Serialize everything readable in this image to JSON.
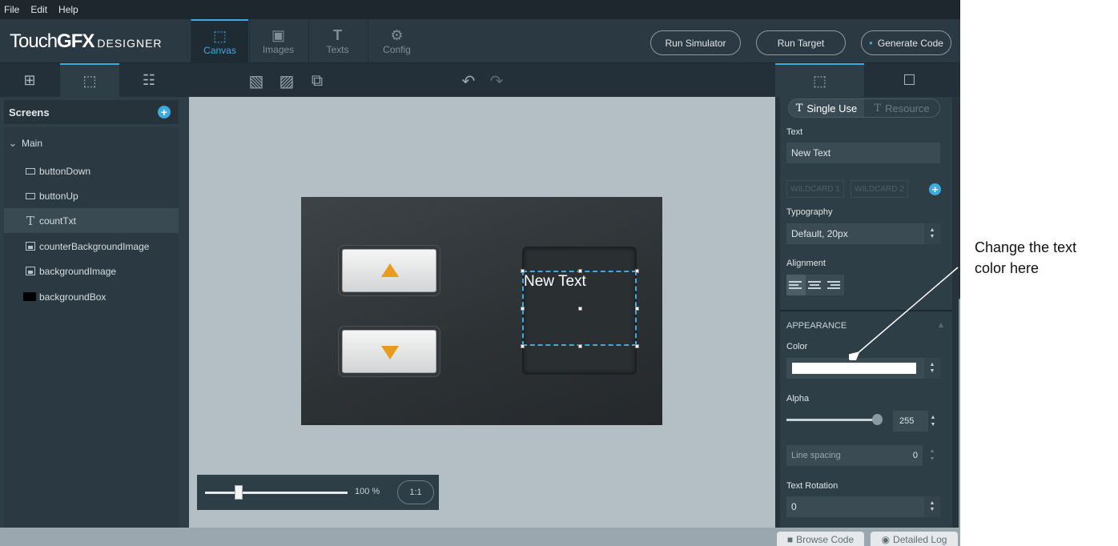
{
  "menu": [
    "File",
    "Edit",
    "Help"
  ],
  "logo": {
    "part1": "Touch",
    "part2": "GFX",
    "part3": "DESIGNER"
  },
  "top_tabs": [
    {
      "label": "Canvas",
      "icon": "canvas-icon"
    },
    {
      "label": "Images",
      "icon": "image-icon"
    },
    {
      "label": "Texts",
      "icon": "text-icon"
    },
    {
      "label": "Config",
      "icon": "gear-icon"
    }
  ],
  "actions": {
    "run_simulator": "Run Simulator",
    "run_target": "Run Target",
    "generate_code": "Generate Code"
  },
  "left_panel": {
    "screens_title": "Screens",
    "screen_name": "Main",
    "widgets": [
      {
        "label": "buttonDown",
        "icon": "button-icon"
      },
      {
        "label": "buttonUp",
        "icon": "button-icon"
      },
      {
        "label": "countTxt",
        "icon": "text-icon",
        "selected": true
      },
      {
        "label": "counterBackgroundImage",
        "icon": "image-icon"
      },
      {
        "label": "backgroundImage",
        "icon": "image-icon"
      },
      {
        "label": "backgroundBox",
        "icon": "box-icon"
      }
    ]
  },
  "canvas": {
    "text_value": "New Text",
    "zoom_level": "100 %",
    "zoom_fraction": 0.25,
    "zoom_reset": "1:1"
  },
  "properties": {
    "single_use": "Single Use",
    "resource": "Resource",
    "text_label": "Text",
    "text_value": "New Text",
    "wildcard1": "WILDCARD 1",
    "wildcard2": "WILDCARD 2",
    "typography_label": "Typography",
    "typography_value": "Default, 20px",
    "alignment_label": "Alignment",
    "appearance_label": "APPEARANCE",
    "color_label": "Color",
    "color_value": "#ffffff",
    "alpha_label": "Alpha",
    "alpha_value": "255",
    "line_spacing_label": "Line spacing",
    "line_spacing_value": "0",
    "rotation_label": "Text Rotation",
    "rotation_value": "0"
  },
  "bottom": {
    "browse_code": "Browse Code",
    "detailed_log": "Detailed Log"
  },
  "annotation": {
    "text": "Change the text color here"
  },
  "colors": {
    "accent": "#3fa9e0",
    "arrow_orange": "#e89b1c"
  }
}
